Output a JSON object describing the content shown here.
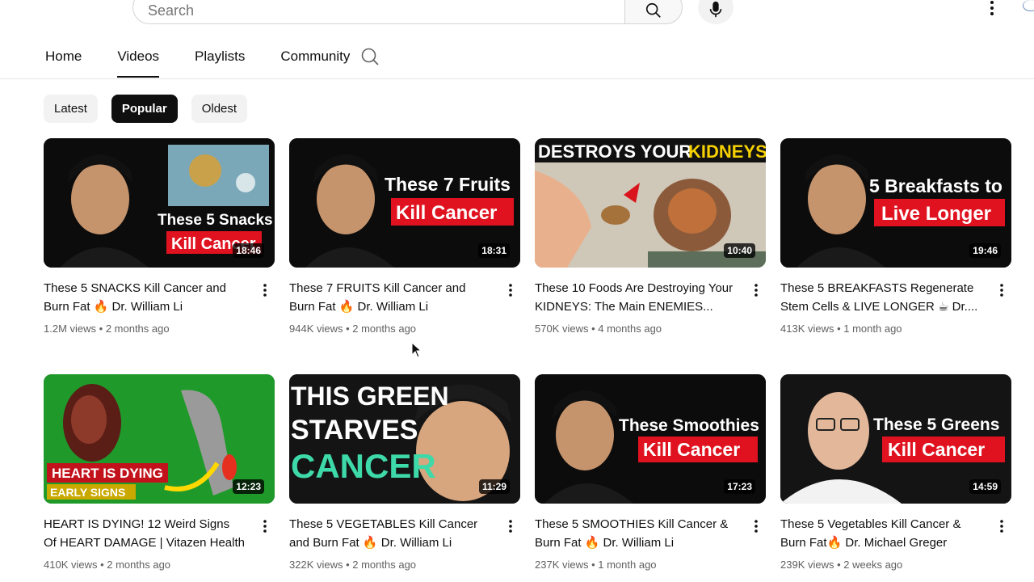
{
  "search": {
    "placeholder": "Search"
  },
  "tabs": [
    {
      "label": "Home"
    },
    {
      "label": "Videos"
    },
    {
      "label": "Playlists"
    },
    {
      "label": "Community"
    }
  ],
  "chips": [
    {
      "label": "Latest"
    },
    {
      "label": "Popular"
    },
    {
      "label": "Oldest"
    }
  ],
  "videos": [
    {
      "title": "These 5 SNACKS Kill Cancer and Burn Fat 🔥 Dr. William Li",
      "views": "1.2M views",
      "age": "2 months ago",
      "duration": "18:46",
      "overlay1": "These 5 Snacks",
      "overlay2": "Kill Cancer"
    },
    {
      "title": "These 7 FRUITS Kill Cancer and Burn Fat 🔥 Dr. William Li",
      "views": "944K views",
      "age": "2 months ago",
      "duration": "18:31",
      "overlay1": "These 7 Fruits",
      "overlay2": "Kill Cancer"
    },
    {
      "title": "These 10 Foods Are Destroying Your KIDNEYS: The Main ENEMIES...",
      "views": "570K views",
      "age": "4 months ago",
      "duration": "10:40",
      "overlay1": "DESTROYS YOUR",
      "overlay2": "KIDNEYS"
    },
    {
      "title": "These 5 BREAKFASTS Regenerate Stem Cells & LIVE LONGER ☕ Dr....",
      "views": "413K views",
      "age": "1 month ago",
      "duration": "19:46",
      "overlay1": "5 Breakfasts to",
      "overlay2": "Live Longer"
    },
    {
      "title": "HEART IS DYING! 12 Weird Signs Of HEART DAMAGE | Vitazen Health",
      "views": "410K views",
      "age": "2 months ago",
      "duration": "12:23",
      "overlay1": "HEART IS DYING",
      "overlay2": "EARLY SIGNS"
    },
    {
      "title": "These 5 VEGETABLES Kill Cancer and Burn Fat 🔥 Dr. William Li",
      "views": "322K views",
      "age": "2 months ago",
      "duration": "11:29",
      "overlay1": "THIS GREEN",
      "overlay2": "STARVES",
      "overlay3": "CANCER"
    },
    {
      "title": "These 5 SMOOTHIES Kill Cancer & Burn Fat 🔥 Dr. William Li",
      "views": "237K views",
      "age": "1 month ago",
      "duration": "17:23",
      "overlay1": "These Smoothies",
      "overlay2": "Kill Cancer"
    },
    {
      "title": "These 5 Vegetables Kill Cancer & Burn Fat🔥 Dr. Michael Greger",
      "views": "239K views",
      "age": "2 weeks ago",
      "duration": "14:59",
      "overlay1": "These 5 Greens",
      "overlay2": "Kill Cancer"
    }
  ]
}
